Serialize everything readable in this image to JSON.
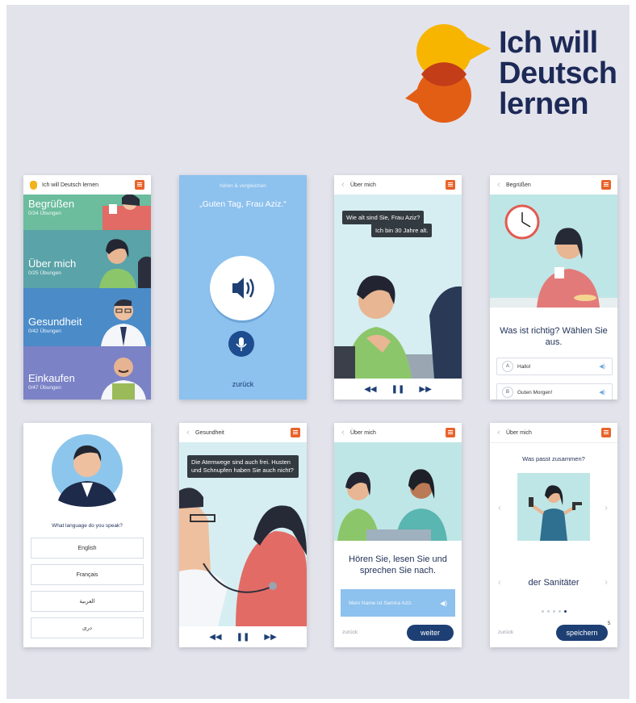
{
  "logo": {
    "line1": "Ich will",
    "line2": "Deutsch",
    "line3": "lernen"
  },
  "screen1": {
    "title": "Ich will Deutsch lernen",
    "categories": [
      {
        "name": "Begrüßen",
        "sub": "0/34 Übungen",
        "color": "#6bbd9d"
      },
      {
        "name": "Über mich",
        "sub": "0/25 Übungen",
        "color": "#5aa3a8"
      },
      {
        "name": "Gesundheit",
        "sub": "0/42 Übungen",
        "color": "#4a8bc8"
      },
      {
        "name": "Einkaufen",
        "sub": "0/47 Übungen",
        "color": "#7b82c6"
      }
    ]
  },
  "screen2": {
    "instruction": "hören & vergleichen",
    "phrase": "„Guten Tag, Frau Aziz.“",
    "back": "zurück"
  },
  "screen3": {
    "title": "Über mich",
    "bubble1": "Wie alt sind Sie, Frau Aziz?",
    "bubble2": "Ich bin 30 Jahre alt."
  },
  "screen4": {
    "title": "Begrüßen",
    "question": "Was ist richtig? Wählen Sie aus.",
    "answers": [
      {
        "letter": "A",
        "text": "Hallo!"
      },
      {
        "letter": "B",
        "text": "Guten Morgen!"
      }
    ]
  },
  "screen5": {
    "question": "What language do you speak?",
    "languages": [
      "English",
      "Français",
      "العربية",
      "دری"
    ]
  },
  "screen6": {
    "title": "Gesundheit",
    "bubble": "Die Atemwege sind auch frei. Husten und Schnupfen haben Sie auch nicht?"
  },
  "screen7": {
    "title": "Über mich",
    "instruction": "Hören Sie, lesen Sie und sprechen Sie nach.",
    "sentence": "Mein Name ist Samira Aziz.",
    "back": "zurück",
    "next": "weiter"
  },
  "screen8": {
    "title": "Über mich",
    "question": "Was passt zusammen?",
    "word": "der Sanitäter",
    "back": "zurück",
    "save": "speichern",
    "badge": "5"
  },
  "colors": {
    "orange": "#e8632a",
    "navy": "#1d2a57",
    "yellow": "#f7b500"
  }
}
